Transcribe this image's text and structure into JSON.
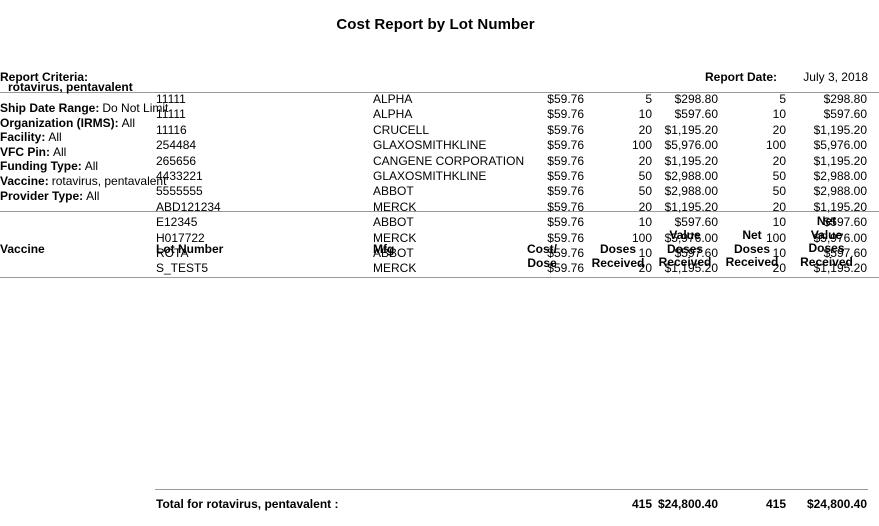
{
  "report": {
    "title": "Cost Report by Lot Number",
    "criteria_label": "Report Criteria:",
    "report_date_label": "Report Date:",
    "report_date_value": "July 3, 2018"
  },
  "criteria": [
    {
      "key": "Ship Date Range:",
      "value": "Do Not Limit"
    },
    {
      "key": "Organization (IRMS):",
      "value": "All"
    },
    {
      "key": "Facility:",
      "value": "All"
    },
    {
      "key": "VFC Pin:",
      "value": "All"
    },
    {
      "key": "Funding Type:",
      "value": "All"
    },
    {
      "key": "Vaccine:",
      "value": "rotavirus, pentavalent"
    },
    {
      "key": "Provider Type:",
      "value": "All"
    }
  ],
  "table": {
    "headers": {
      "vaccine": "Vaccine",
      "lot_number": "Lot Number",
      "mfg": "Mfg",
      "cost_dose": "Cost/\nDose",
      "doses_received": "Doses\nReceived",
      "value_doses_received": "Value\nDoses\nReceived",
      "net_doses_received": "Net\nDoses\nReceived",
      "net_value_doses_received": "Net\nValue\nDoses\nReceived"
    },
    "group_label": "rotavirus, pentavalent",
    "rows": [
      {
        "lot": "11111",
        "mfg": "ALPHA",
        "cost": "$59.76",
        "doses": "5",
        "value": "$298.80",
        "net_doses": "5",
        "net_value": "$298.80"
      },
      {
        "lot": "11111",
        "mfg": "ALPHA",
        "cost": "$59.76",
        "doses": "10",
        "value": "$597.60",
        "net_doses": "10",
        "net_value": "$597.60"
      },
      {
        "lot": "11116",
        "mfg": "CRUCELL",
        "cost": "$59.76",
        "doses": "20",
        "value": "$1,195.20",
        "net_doses": "20",
        "net_value": "$1,195.20"
      },
      {
        "lot": "254484",
        "mfg": "GLAXOSMITHKLINE",
        "cost": "$59.76",
        "doses": "100",
        "value": "$5,976.00",
        "net_doses": "100",
        "net_value": "$5,976.00"
      },
      {
        "lot": "265656",
        "mfg": "CANGENE CORPORATION",
        "cost": "$59.76",
        "doses": "20",
        "value": "$1,195.20",
        "net_doses": "20",
        "net_value": "$1,195.20"
      },
      {
        "lot": "4433221",
        "mfg": "GLAXOSMITHKLINE",
        "cost": "$59.76",
        "doses": "50",
        "value": "$2,988.00",
        "net_doses": "50",
        "net_value": "$2,988.00"
      },
      {
        "lot": "5555555",
        "mfg": "ABBOT",
        "cost": "$59.76",
        "doses": "50",
        "value": "$2,988.00",
        "net_doses": "50",
        "net_value": "$2,988.00"
      },
      {
        "lot": "ABD121234",
        "mfg": "MERCK",
        "cost": "$59.76",
        "doses": "20",
        "value": "$1,195.20",
        "net_doses": "20",
        "net_value": "$1,195.20"
      },
      {
        "lot": "E12345",
        "mfg": "ABBOT",
        "cost": "$59.76",
        "doses": "10",
        "value": "$597.60",
        "net_doses": "10",
        "net_value": "$597.60"
      },
      {
        "lot": "H017722",
        "mfg": "MERCK",
        "cost": "$59.76",
        "doses": "100",
        "value": "$5,976.00",
        "net_doses": "100",
        "net_value": "$5,976.00"
      },
      {
        "lot": "ROTA",
        "mfg": "ABBOT",
        "cost": "$59.76",
        "doses": "10",
        "value": "$597.60",
        "net_doses": "10",
        "net_value": "$597.60"
      },
      {
        "lot": "S_TEST5",
        "mfg": "MERCK",
        "cost": "$59.76",
        "doses": "20",
        "value": "$1,195.20",
        "net_doses": "20",
        "net_value": "$1,195.20"
      }
    ],
    "total": {
      "label": "Total for rotavirus, pentavalent :",
      "doses": "415",
      "value": "$24,800.40",
      "net_doses": "415",
      "net_value": "$24,800.40"
    }
  },
  "colors": {
    "text": "#000000",
    "rule": "#9a9a9a",
    "background": "#ffffff"
  }
}
